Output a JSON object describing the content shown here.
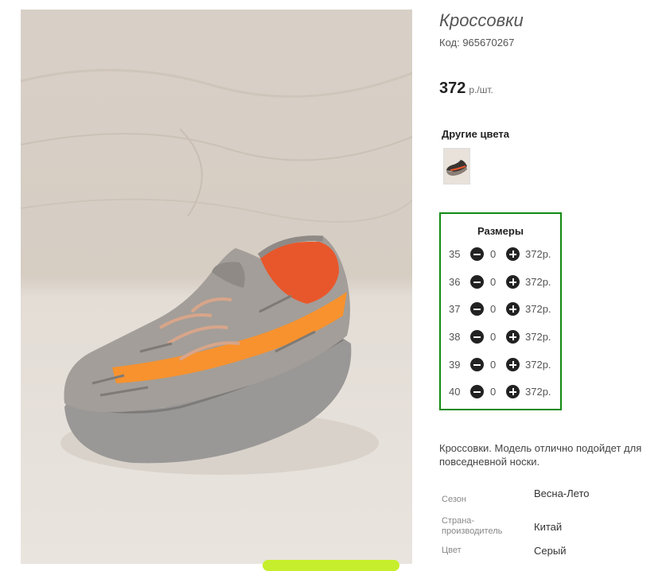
{
  "product": {
    "title": "Кроссовки",
    "code": "Код: 965670267",
    "price": "372",
    "price_unit": "р./шт.",
    "image_alt": "sneaker-photo"
  },
  "other_colors": {
    "label": "Другие цвета"
  },
  "sizes": {
    "header": "Размеры",
    "rows": [
      {
        "size": "35",
        "qty": "0",
        "price": "372р."
      },
      {
        "size": "36",
        "qty": "0",
        "price": "372р."
      },
      {
        "size": "37",
        "qty": "0",
        "price": "372р."
      },
      {
        "size": "38",
        "qty": "0",
        "price": "372р."
      },
      {
        "size": "39",
        "qty": "0",
        "price": "372р."
      },
      {
        "size": "40",
        "qty": "0",
        "price": "372р."
      }
    ],
    "border_color": "#118a11"
  },
  "description": "Кроссовки. Модель отлично подойдет для повседневной носки.",
  "properties": [
    {
      "key": "Сезон",
      "value": "Весна-Лето"
    },
    {
      "key": "Страна-производитель",
      "value": "Китай"
    },
    {
      "key": "Цвет",
      "value": "Серый"
    }
  ],
  "colors": {
    "accent_green": "#c6ee2c",
    "shoe_orange": "#f7922f",
    "shoe_grey": "#9a9896"
  }
}
